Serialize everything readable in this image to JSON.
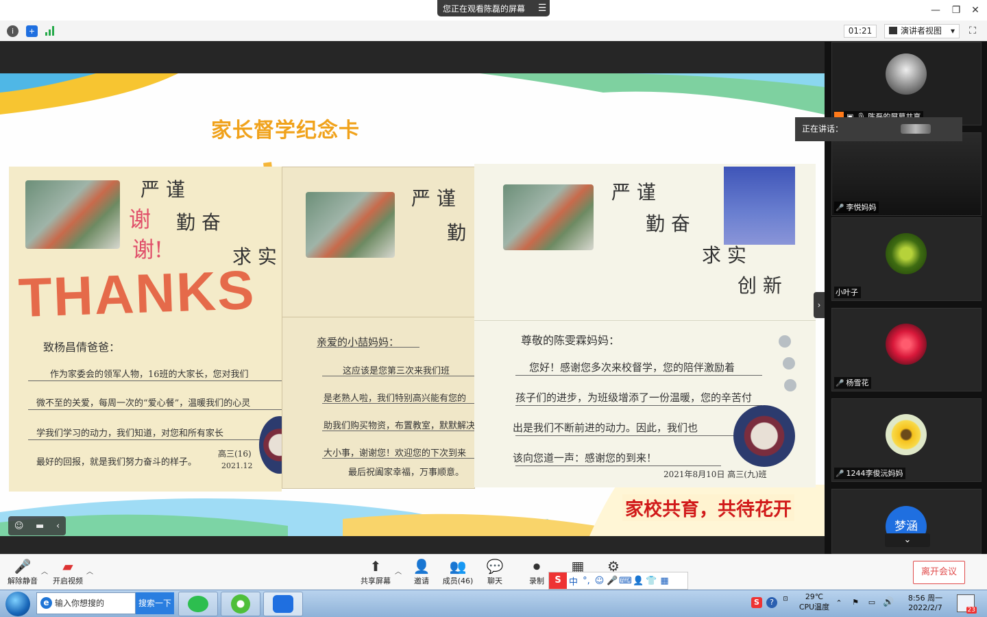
{
  "title_bar": {
    "viewing_banner": "您正在观看陈磊的屏幕",
    "menu_glyph": "☰",
    "min": "—",
    "max": "❐",
    "close": "✕"
  },
  "info_bar": {
    "timer": "01:21",
    "view_mode": "演讲者视图",
    "view_caret": "▾"
  },
  "slide": {
    "title": "家长督学纪念卡",
    "motto": "家校共育，共待花开",
    "card1": {
      "motto_col1": "严 谨",
      "motto_col2": "勤 奋",
      "motto_col3": "求 实",
      "big_text": "THANKS",
      "xie": "谢",
      "xie2": "谢!",
      "greeting": "致杨昌倩爸爸：",
      "lines": [
        "作为家委会的领军人物，16班的大家长，您对我们",
        "微不至的关爱，每周一次的“爱心餐”，温暖我们的心灵",
        "学我们学习的动力，我们知道，对您和所有家长",
        "最好的回报，就是我们努力奋斗的样子。"
      ],
      "signature": "高三(16)",
      "date": "2021.12"
    },
    "card2": {
      "motto_col1": "严 谨",
      "motto_col2": "勤",
      "greeting": "亲爱的小喆妈妈：",
      "lines": [
        "这应该是您第三次来我们班",
        "是老熟人啦，我们特别高兴能有您的",
        "助我们购买物资，布置教室，默默解决",
        "大小事，谢谢您！欢迎您的下次到来",
        "最后祝阖家幸福，万事顺意。"
      ]
    },
    "card3": {
      "motto_col1": "严 谨",
      "motto_col2": "勤 奋",
      "motto_col3": "求 实",
      "motto_col4": "创 新",
      "greeting": "尊敬的陈雯霖妈妈：",
      "lines": [
        "您好！感谢您多次来校督学，您的陪伴激励着",
        "孩子们的进步，为班级增添了一份温暖，您的辛苦付",
        "出是我们不断前进的动力。因此，我们也",
        "该向您道一声：感谢您的到来！"
      ],
      "signature": "2021年8月10日 高三(九)班"
    },
    "slide_controls": [
      "☺",
      "▬",
      "‹"
    ]
  },
  "gallery": {
    "speaking_label": "正在讲话：",
    "scroll_down": "⌄",
    "tiles": [
      {
        "name": "陈磊的屏幕共享"
      },
      {
        "name": "李悦妈妈"
      },
      {
        "name": "小叶子"
      },
      {
        "name": "杨雪花"
      },
      {
        "name": "1244李俊沅妈妈"
      },
      {
        "name": "",
        "initials": "梦涵"
      }
    ]
  },
  "toolbar": {
    "unmute": "解除静音",
    "start_video": "开启视频",
    "share_screen": "共享屏幕",
    "invite": "邀请",
    "members": "成员(46)",
    "chat": "聊天",
    "record": "录制",
    "apps": "",
    "settings": "",
    "leave": "离开会议"
  },
  "ime": {
    "logo": "S",
    "mode": "中",
    "punct": "°,",
    "emoji": "☺",
    "mic": "🎤",
    "keyboard": "⌨",
    "skin": "👕",
    "grid": "▦"
  },
  "taskbar": {
    "search_placeholder": "输入你想搜的",
    "search_button": "搜索一下",
    "temperature": "29℃",
    "cpu_label": "CPU温度",
    "time": "8:56 周一",
    "date": "2022/2/7",
    "notification_count": "23"
  },
  "colors": {
    "slide_title": "#f0a21b",
    "motto": "#d11a1a",
    "leave": "#e04b4b",
    "avatar_blue": "#1f6fe0"
  }
}
